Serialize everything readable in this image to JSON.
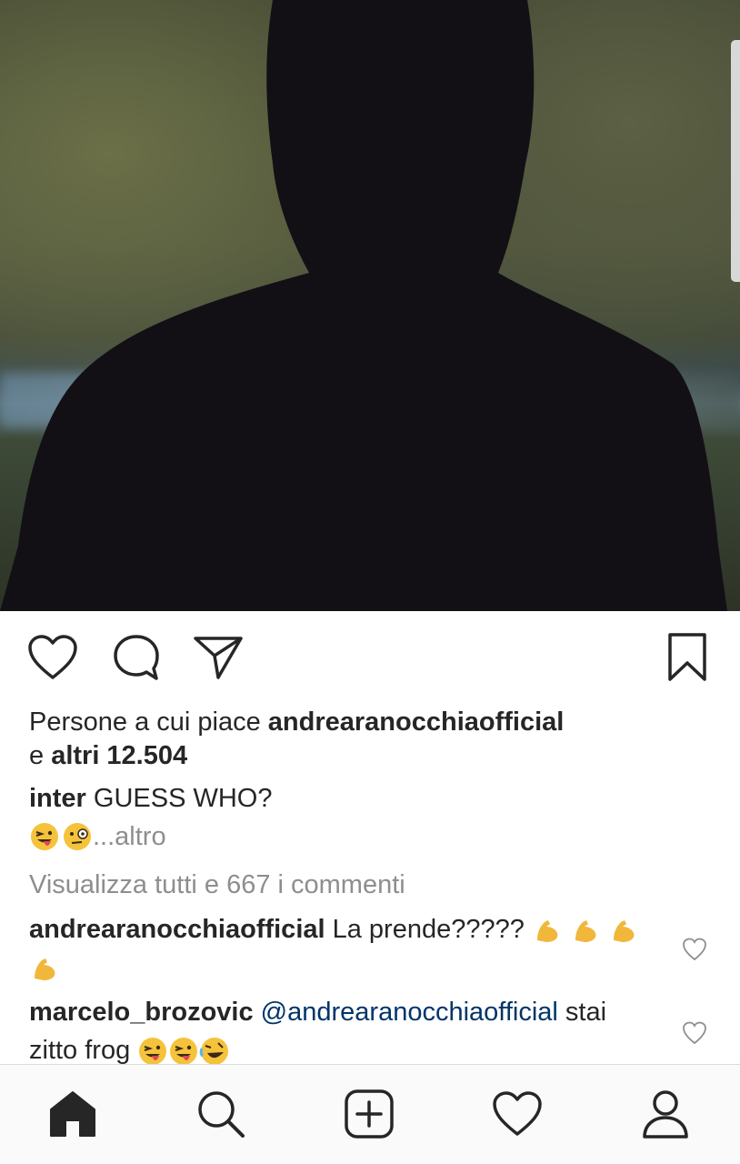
{
  "post": {
    "likes_prefix": "Persone a cui piace ",
    "liked_by": "andrearanocchiaofficial",
    "likes_and": "e ",
    "likes_others": "altri 12.504",
    "caption_user": "inter",
    "caption_text": " GUESS WHO?",
    "caption_more": "...altro",
    "view_all_comments": "Visualizza tutti e 667 i commenti"
  },
  "comments": [
    {
      "user": "andrearanocchiaofficial",
      "text": " La prende????? "
    },
    {
      "user": "marcelo_brozovic",
      "mention": "@andrearanocchiaofficial",
      "text_line1": " stai",
      "text_line2": "zitto frog "
    }
  ],
  "icons": {
    "like": "heart-outline-icon",
    "comment": "comment-bubble-icon",
    "share": "paper-plane-icon",
    "save": "bookmark-icon",
    "tab_home": "home-icon",
    "tab_search": "search-icon",
    "tab_new": "new-post-icon",
    "tab_activity": "heart-icon",
    "tab_profile": "profile-icon"
  },
  "colors": {
    "text": "#262626",
    "muted": "#8e8e8e",
    "mention": "#003569",
    "divider": "#dbdbdb"
  }
}
